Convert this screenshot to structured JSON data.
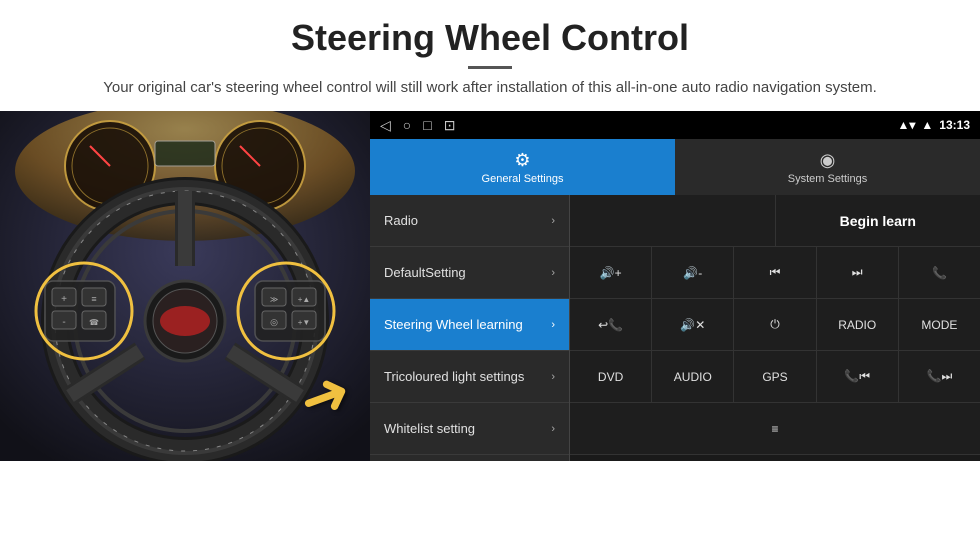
{
  "header": {
    "title": "Steering Wheel Control",
    "subtitle": "Your original car's steering wheel control will still work after installation of this all-in-one auto radio navigation system."
  },
  "statusBar": {
    "navBack": "◁",
    "navHome": "○",
    "navRecent": "□",
    "navCast": "⊡",
    "signal": "▲",
    "wifi": "▾",
    "time": "13:13"
  },
  "tabs": [
    {
      "label": "General Settings",
      "icon": "⚙",
      "active": true
    },
    {
      "label": "System Settings",
      "icon": "◉",
      "active": false
    }
  ],
  "menu": [
    {
      "label": "Radio",
      "active": false
    },
    {
      "label": "DefaultSetting",
      "active": false
    },
    {
      "label": "Steering Wheel learning",
      "active": true
    },
    {
      "label": "Tricoloured light settings",
      "active": false
    },
    {
      "label": "Whitelist setting",
      "active": false
    }
  ],
  "controls": {
    "beginLearn": "Begin learn",
    "row1": [
      {
        "icon": "🔊+",
        "label": ""
      },
      {
        "icon": "🔊-",
        "label": ""
      },
      {
        "icon": "⏮",
        "label": ""
      },
      {
        "icon": "⏭",
        "label": ""
      },
      {
        "icon": "📞",
        "label": ""
      }
    ],
    "row2": [
      {
        "icon": "📞↩",
        "label": ""
      },
      {
        "icon": "🔊✕",
        "label": ""
      },
      {
        "icon": "⏻",
        "label": ""
      },
      {
        "text": "RADIO",
        "label": ""
      },
      {
        "text": "MODE",
        "label": ""
      }
    ],
    "row3": [
      {
        "text": "DVD",
        "label": ""
      },
      {
        "text": "AUDIO",
        "label": ""
      },
      {
        "text": "GPS",
        "label": ""
      },
      {
        "icon": "📞⏮",
        "label": ""
      },
      {
        "icon": "📞⏭",
        "label": ""
      }
    ],
    "row4": [
      {
        "icon": "≡",
        "label": ""
      }
    ]
  }
}
